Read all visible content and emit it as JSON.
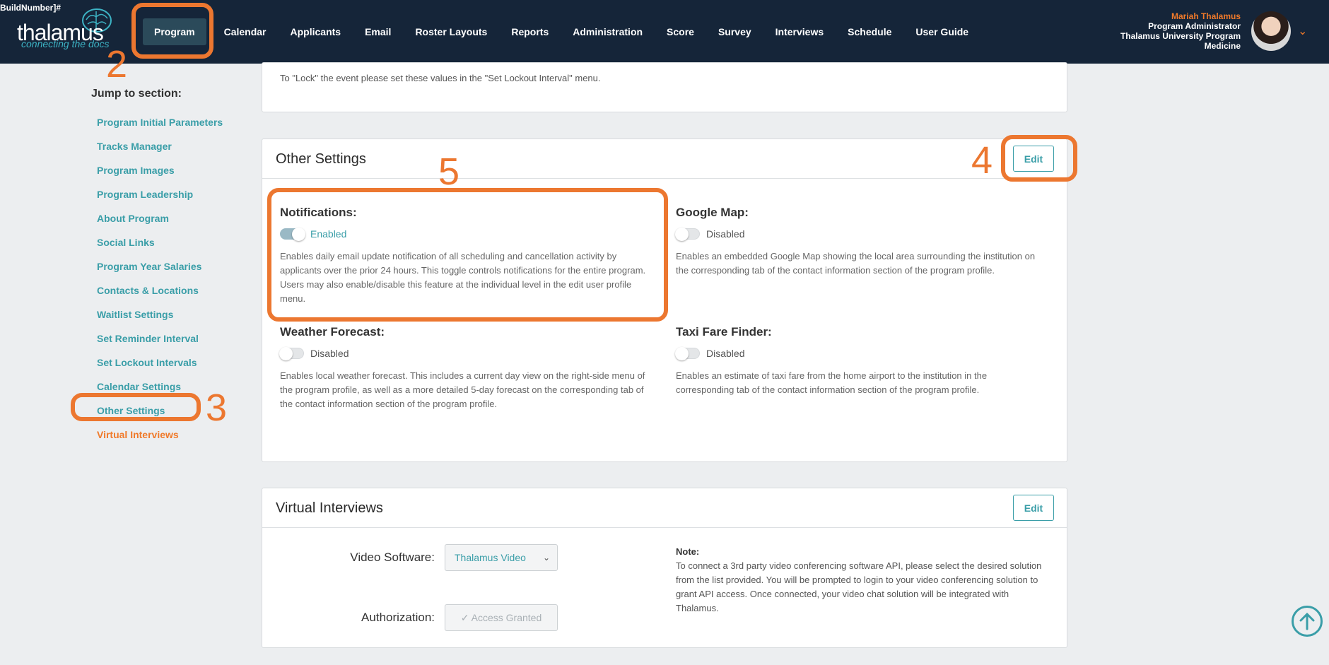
{
  "build_tag": "BuildNumber]#",
  "logo": {
    "word": "thalamus",
    "tagline": "connecting the docs"
  },
  "nav": {
    "items": [
      {
        "label": "Program",
        "active": true
      },
      {
        "label": "Calendar"
      },
      {
        "label": "Applicants"
      },
      {
        "label": "Email"
      },
      {
        "label": "Roster Layouts"
      },
      {
        "label": "Reports"
      },
      {
        "label": "Administration"
      },
      {
        "label": "Score"
      },
      {
        "label": "Survey"
      },
      {
        "label": "Interviews"
      },
      {
        "label": "Schedule"
      },
      {
        "label": "User Guide"
      }
    ]
  },
  "user": {
    "name": "Mariah Thalamus",
    "role": "Program Administrator",
    "org_line1": "Thalamus University Program",
    "org_line2": "Medicine"
  },
  "sidebar": {
    "title": "Jump to section:",
    "items": [
      "Program Initial Parameters",
      "Tracks Manager",
      "Program Images",
      "Program Leadership",
      "About Program",
      "Social Links",
      "Program Year Salaries",
      "Contacts & Locations",
      "Waitlist Settings",
      "Set Reminder Interval",
      "Set Lockout Intervals",
      "Calendar Settings",
      "Other Settings",
      "Virtual Interviews"
    ]
  },
  "lockout_card": {
    "text": "To \"Lock\" the event please set these values in the \"Set Lockout Interval\" menu."
  },
  "other_settings": {
    "title": "Other Settings",
    "edit_label": "Edit",
    "settings": [
      {
        "label": "Notifications:",
        "state": "Enabled",
        "enabled": true,
        "desc": "Enables daily email update notification of all scheduling and cancellation activity by applicants over the prior 24 hours. This toggle controls notifications for the entire program. Users may also enable/disable this feature at the individual level in the edit user profile menu."
      },
      {
        "label": "Google Map:",
        "state": "Disabled",
        "enabled": false,
        "desc": "Enables an embedded Google Map showing the local area surrounding the institution on the corresponding tab of the contact information section of the program profile."
      },
      {
        "label": "Weather Forecast:",
        "state": "Disabled",
        "enabled": false,
        "desc": "Enables local weather forecast. This includes a current day view on the right-side menu of the program profile, as well as a more detailed 5-day forecast on the corresponding tab of the contact information section of the program profile."
      },
      {
        "label": "Taxi Fare Finder:",
        "state": "Disabled",
        "enabled": false,
        "desc": "Enables an estimate of taxi fare from the home airport to the institution in the corresponding tab of the contact information section of the program profile."
      }
    ]
  },
  "virtual_interviews": {
    "title": "Virtual Interviews",
    "edit_label": "Edit",
    "video_software_label": "Video Software:",
    "video_software_value": "Thalamus Video",
    "authorization_label": "Authorization:",
    "authorization_value": "Access Granted",
    "note_title": "Note:",
    "note_text": "To connect a 3rd party video conferencing software API, please select the desired solution from the list provided. You will be prompted to login to your video conferencing solution to grant API access. Once connected, your video chat solution will be integrated with Thalamus."
  },
  "annotations": [
    "2",
    "3",
    "4",
    "5"
  ],
  "colors": {
    "header": "#152539",
    "accent": "#3a9ea8",
    "orange": "#ec7730"
  },
  "icons": {
    "brain": "brain-icon",
    "chevron": "chevron-down-icon",
    "scroll_top": "arrow-up-circle-icon",
    "check": "check-icon"
  }
}
